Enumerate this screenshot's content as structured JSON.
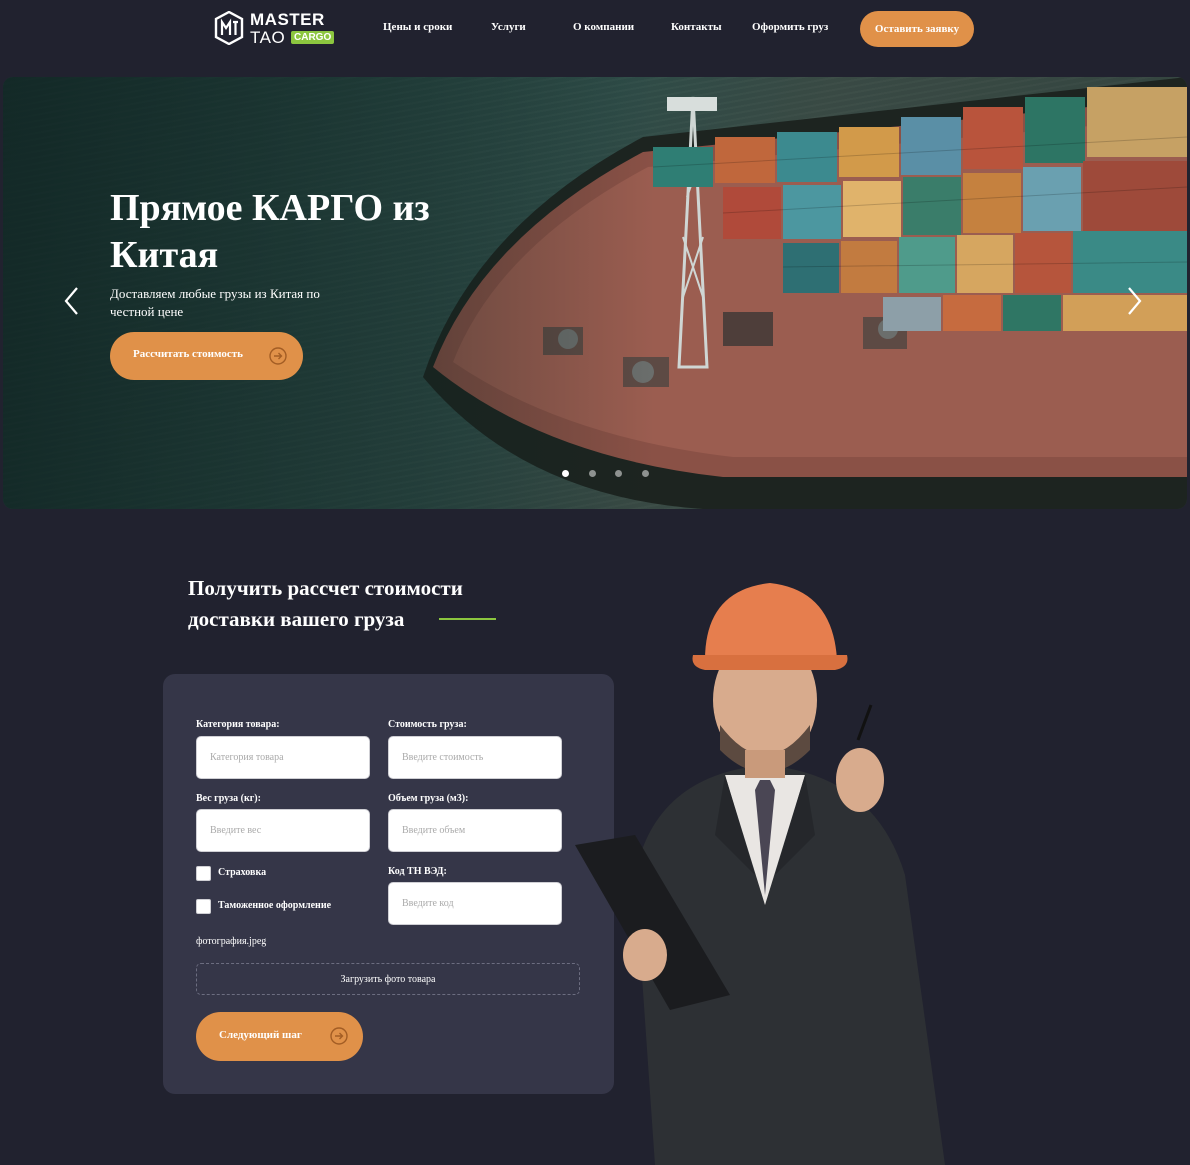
{
  "header": {
    "logo": {
      "line1": "MASTER",
      "line2": "TAO",
      "badge": "CARGO"
    },
    "nav": [
      {
        "label": "Цены и сроки"
      },
      {
        "label": "Услуги"
      },
      {
        "label": "О компании"
      },
      {
        "label": "Контакты"
      },
      {
        "label": "Оформить груз"
      }
    ],
    "cta_label": "Оставить заявку"
  },
  "hero": {
    "title": "Прямое КАРГО из Китая",
    "subtitle": "Доставляем любые грузы из Китая по честной цене",
    "button_label": "Рассчитать стоимость",
    "icons": {
      "prev": "chevron-left-icon",
      "next": "chevron-right-icon"
    },
    "slides_count": 4,
    "active_slide": 1
  },
  "calculator": {
    "title": "Получить рассчет стоимости доставки вашего груза",
    "fields": {
      "category": {
        "label": "Категория товара:",
        "placeholder": "Категория товара"
      },
      "cost": {
        "label": "Стоимость груза:",
        "placeholder": "Введите стоимость"
      },
      "weight": {
        "label": "Вес груза (кг):",
        "placeholder": "Введите вес"
      },
      "volume": {
        "label": "Объем груза (м3):",
        "placeholder": "Введите объем"
      },
      "tnved": {
        "label": "Код ТН ВЭД:",
        "placeholder": "Введите код"
      }
    },
    "checkboxes": {
      "insurance": {
        "label": "Страховка",
        "checked": false
      },
      "customs": {
        "label": "Таможенное оформление",
        "checked": false
      }
    },
    "file_name": "фотография.jpeg",
    "upload_label": "Загрузить фото товара",
    "next_label": "Следующий шаг"
  },
  "colors": {
    "background": "#21222f",
    "card": "#353648",
    "accent_orange": "#e09149",
    "accent_green": "#8cc63f"
  }
}
